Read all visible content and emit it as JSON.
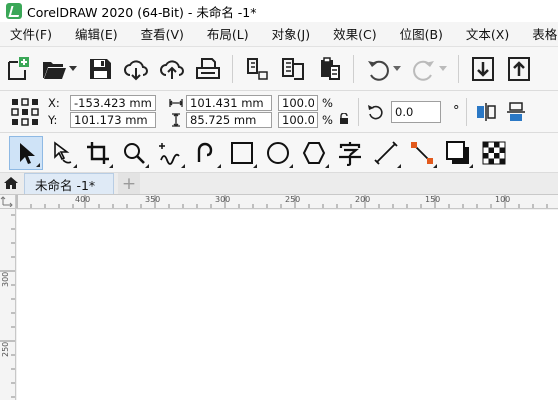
{
  "window": {
    "title": "CorelDRAW 2020 (64-Bit) - 未命名 -1*"
  },
  "menu": [
    "文件(F)",
    "编辑(E)",
    "查看(V)",
    "布局(L)",
    "对象(J)",
    "效果(C)",
    "位图(B)",
    "文本(X)",
    "表格(T)"
  ],
  "toolbar": {
    "icons": [
      "new-document-icon",
      "open-folder-icon",
      "save-icon",
      "cloud-import-icon",
      "cloud-export-icon",
      "print-icon",
      "import-icon",
      "export-icon",
      "publish-pdf-icon",
      "undo-icon",
      "redo-icon",
      "import-down-icon",
      "export-up-icon"
    ]
  },
  "properties": {
    "x_label": "X:",
    "y_label": "Y:",
    "x_value": "-153.423 mm",
    "y_value": "101.173 mm",
    "width_value": "101.431 mm",
    "height_value": "85.725 mm",
    "scale_w": "100.0",
    "scale_h": "100.0",
    "percent": "%",
    "rotation_value": "0.0",
    "degree": "°"
  },
  "tools": [
    "pick-tool",
    "shape-tool",
    "crop-tool",
    "zoom-tool",
    "freehand-tool",
    "artistic-media-tool",
    "rectangle-tool",
    "ellipse-tool",
    "polygon-tool",
    "text-tool",
    "parallel-dimension-tool",
    "connector-tool",
    "drop-shadow-tool",
    "transparency-tool"
  ],
  "tabs": {
    "document": "未命名 -1*",
    "add": "+"
  },
  "ruler": {
    "h_labels": [
      "400",
      "350",
      "300",
      "250",
      "200",
      "150",
      "100"
    ],
    "v_labels": [
      "300",
      "250"
    ]
  },
  "colors": {
    "accent": "#3aa757",
    "tab_active": "#dfeaf6",
    "canvas": "#ffffff"
  }
}
